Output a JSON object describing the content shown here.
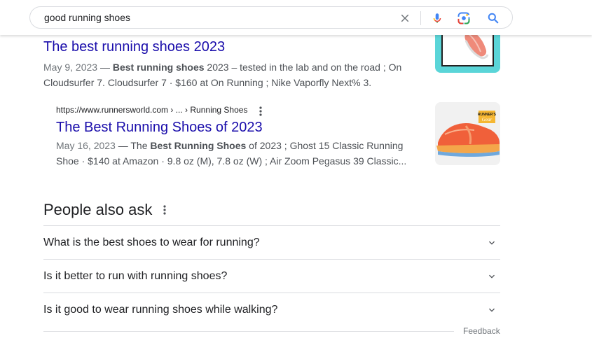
{
  "search": {
    "query": "good running shoes",
    "clear_label": "Clear",
    "voice_label": "Search by voice",
    "lens_label": "Search by image",
    "submit_label": "Search"
  },
  "results": [
    {
      "title": "The best running shoes 2023",
      "date": "May 9, 2023",
      "sep": " — ",
      "bold": "Best running shoes",
      "snippet_rest": " 2023 – tested in the lab and on the road ; On Cloudsurfer 7. Cloudsurfer 7 · $160 at On Running ; Nike Vaporfly Next% 3.",
      "thumb_icon": "shoe-thumbnail"
    },
    {
      "url": "https://www.runnersworld.com › ... › Running Shoes",
      "title": "The Best Running Shoes of 2023",
      "date": "May 16, 2023",
      "sep": " — The ",
      "bold": "Best Running Shoes",
      "snippet_rest": " of 2023 ; Ghost 15 Classic Running Shoe · $140 at Amazon · 9.8 oz (M), 7.8 oz (W) ; Air Zoom Pegasus 39 Classic...",
      "badge_top": "RUNNER'S",
      "badge_bottom": "Gear",
      "thumb_icon": "shoe-thumbnail"
    }
  ],
  "people_also_ask": {
    "heading": "People also ask",
    "questions": [
      "What is the best shoes to wear for running?",
      "Is it better to run with running shoes?",
      "Is it good to wear running shoes while walking?"
    ],
    "feedback": "Feedback"
  },
  "colors": {
    "link": "#1a0dab",
    "snippet": "#4d5156",
    "meta": "#70757a",
    "google_blue": "#4285f4",
    "google_red": "#ea4335",
    "thumb1_bg": "#5ad5d8"
  }
}
